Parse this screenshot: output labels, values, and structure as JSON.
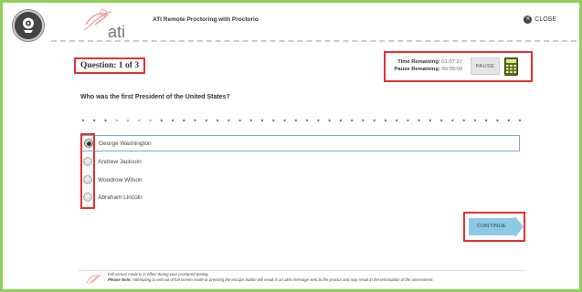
{
  "header": {
    "title": "ATI Remote Proctoring with Proctorio",
    "logo_text": "ati",
    "close_label": "CLOSE"
  },
  "question_counter": "Question: 1 of 3",
  "timer": {
    "time_remaining_label": "Time Remaining:",
    "time_remaining_value": "01:07:27",
    "pause_remaining_label": "Pause Remaining:",
    "pause_remaining_value": "00:05:00",
    "pause_label": "PAUSE"
  },
  "question_text": "Who was the first President of the United States?",
  "options": [
    {
      "label": "George Washington",
      "selected": true
    },
    {
      "label": "Andrew Jackson",
      "selected": false
    },
    {
      "label": "Woodrow Wilson",
      "selected": false
    },
    {
      "label": "Abraham Lincoln",
      "selected": false
    }
  ],
  "continue_label": "CONTINUE",
  "footer": {
    "line1": "Full screen mode is in effect during your proctored testing.",
    "line2_bold": "Please Note:",
    "line2": "Attempting to exit out of full screen mode or pressing the escape button will result in an alert message sent to the proctor and may result in the termination of the assessment."
  },
  "colors": {
    "frame": "#8fcf5a",
    "highlight": "#e23232",
    "continue": "#8ec9e3",
    "calculator": "#5c6b14",
    "selected_border": "#7da7d8"
  }
}
